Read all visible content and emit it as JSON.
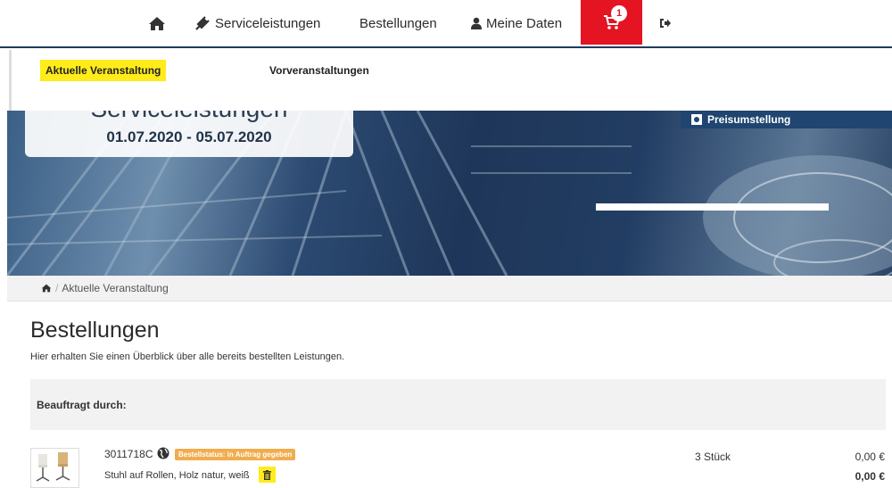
{
  "nav": {
    "home_icon": "home-icon",
    "service_label": "Serviceleistungen",
    "service_icon": "plug-icon",
    "orders_label": "Bestellungen",
    "data_label": "Meine Daten",
    "data_icon": "user-icon",
    "cart_icon": "cart-icon",
    "cart_count": "1",
    "logout_icon": "sign-out-icon"
  },
  "subnav": {
    "current_label": "Aktuelle Veranstaltung",
    "previous_label": "Vorveranstaltungen"
  },
  "hero": {
    "title": "Serviceleistungen",
    "date_range": "01.07.2020 - 05.07.2020",
    "price_label": "Preisumstellung"
  },
  "breadcrumb": {
    "home_icon": "home-icon",
    "current": "Aktuelle Veranstaltung"
  },
  "main": {
    "title": "Bestellungen",
    "description": "Hier erhalten Sie einen Überblick über alle bereits bestellten Leistungen.",
    "commissioned_by_label": "Beauftragt durch:",
    "items": [
      {
        "code": "3011718C",
        "status": "Bestellstatus: in Auftrag gegeben",
        "description": "Stuhl auf Rollen, Holz natur, weiß",
        "quantity": "3 Stück",
        "unit_price": "0,00 €",
        "total": "0,00 €"
      }
    ]
  },
  "colors": {
    "cart_red": "#e41422",
    "highlight_yellow": "#ffec1a",
    "status_orange": "#f0ad4e",
    "nav_border": "#1f3a5f"
  }
}
